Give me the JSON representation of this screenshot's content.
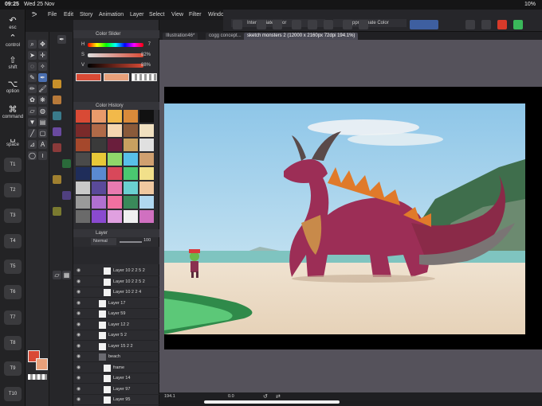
{
  "status": {
    "time": "09:25",
    "date": "Wed 25 Nov",
    "battery": "10%"
  },
  "menu": [
    "File",
    "Edit",
    "Story",
    "Animation",
    "Layer",
    "Select",
    "View",
    "Filter",
    "Window"
  ],
  "floating_panels": {
    "intermediate": "Intermediate Color",
    "approximate": "Approximate Color"
  },
  "keys": {
    "esc": "esc",
    "control": "control",
    "shift": "shift",
    "option": "option",
    "command": "command",
    "space": "space",
    "t": [
      "T1",
      "T2",
      "T3",
      "T4",
      "T5",
      "T6",
      "T7",
      "T8",
      "T9",
      "T10"
    ]
  },
  "color_slider": {
    "title": "Color Slider",
    "h_label": "H",
    "s_label": "S",
    "v_label": "V",
    "h": "7",
    "s": "82%",
    "v": "88%"
  },
  "color_history": {
    "title": "Color History",
    "swatches": [
      "#d94a35",
      "#e89a6b",
      "#f2b94a",
      "#d98a3a",
      "#111111",
      "#7a2a2a",
      "#b06a48",
      "#f5d6b0",
      "#8a5a3a",
      "#f0e0c0",
      "#a5482c",
      "#3a3a3a",
      "#6a1e3c",
      "#c8a060",
      "#e0e0e0",
      "#4a4a4a",
      "#e8c838",
      "#8fd86a",
      "#58c0e8",
      "#d0a070",
      "#1f2d5a",
      "#5a8ad0",
      "#d8485a",
      "#4ac870",
      "#f2e08a",
      "#c9c9c9",
      "#5a4a9a",
      "#e87ab0",
      "#6ad0d0",
      "#f0c8a0",
      "#9a9a9a",
      "#b070d0",
      "#f070a0",
      "#3a8a5a",
      "#b0d8f0",
      "#6a6a6a",
      "#8a4ad0",
      "#e0a0e0",
      "#f0f0f0",
      "#d070c0"
    ]
  },
  "layer_panel": {
    "title": "Layer",
    "blend": "Normal",
    "opacity": "100",
    "layers": [
      {
        "name": "Layer 10 2 2 5 2",
        "indent": 1
      },
      {
        "name": "Layer 10 2 2 5 2",
        "indent": 1
      },
      {
        "name": "Layer 10 2 2 4",
        "indent": 1
      },
      {
        "name": "Layer 17",
        "indent": 0
      },
      {
        "name": "Layer 59",
        "indent": 0
      },
      {
        "name": "Layer 12 2",
        "indent": 0
      },
      {
        "name": "Layer 5 2",
        "indent": 0
      },
      {
        "name": "Layer 15 2 2",
        "indent": 0
      },
      {
        "name": "beach",
        "indent": 0,
        "folder": true
      },
      {
        "name": "frame",
        "indent": 1
      },
      {
        "name": "Layer 14",
        "indent": 1
      },
      {
        "name": "Layer 97",
        "indent": 1
      },
      {
        "name": "Layer 95",
        "indent": 1
      }
    ]
  },
  "tabs": [
    {
      "label": "Illustration46*"
    },
    {
      "label": "cogg concept..."
    },
    {
      "label": "sketch monsters 2 (12000 x 2160px 72dpi 194.1%)",
      "active": true
    }
  ],
  "bottom": {
    "zoom": "194.1",
    "angle": "0.0"
  },
  "colors": {
    "main": "#d94a35",
    "sub": "#e8a07a",
    "accent": "#4a6fb0"
  }
}
